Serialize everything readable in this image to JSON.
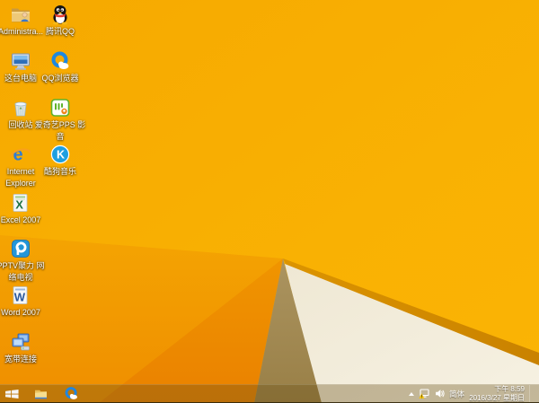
{
  "wallpaper": {
    "amber": "#F9B101",
    "mid_facet": "#F2A001",
    "deep_facet": "#EE8B00",
    "olive_wedge": "#A48D50",
    "cream": "#F4EEDD",
    "edge_band": "#D18700"
  },
  "desktop": {
    "icons": [
      {
        "name": "administrator",
        "line1": "Administra...",
        "line2": ""
      },
      {
        "name": "tencent-qq",
        "line1": "腾讯QQ",
        "line2": ""
      },
      {
        "name": "this-pc",
        "line1": "这台电脑",
        "line2": ""
      },
      {
        "name": "qq-browser",
        "line1": "QQ浏览器",
        "line2": ""
      },
      {
        "name": "recycle-bin",
        "line1": "回收站",
        "line2": ""
      },
      {
        "name": "iqiyi-pps",
        "line1": "爱奇艺PPS 影",
        "line2": "音"
      },
      {
        "name": "internet-explorer",
        "line1": "Internet",
        "line2": "Explorer"
      },
      {
        "name": "kugou-music",
        "line1": "酷狗音乐",
        "line2": ""
      },
      {
        "name": "excel-2007",
        "line1": "Excel 2007",
        "line2": ""
      },
      {
        "name": "pptv",
        "line1": "PPTV聚力 网",
        "line2": "络电视"
      },
      {
        "name": "word-2007",
        "line1": "Word 2007",
        "line2": ""
      },
      {
        "name": "broadband",
        "line1": "宽带连接",
        "line2": ""
      }
    ]
  },
  "taskbar": {
    "buttons": [
      {
        "name": "start"
      },
      {
        "name": "file-explorer"
      },
      {
        "name": "qq-browser"
      }
    ],
    "tray": {
      "ime": "简体",
      "time": "下午 8:59",
      "date": "2016/3/27 星期日"
    }
  }
}
